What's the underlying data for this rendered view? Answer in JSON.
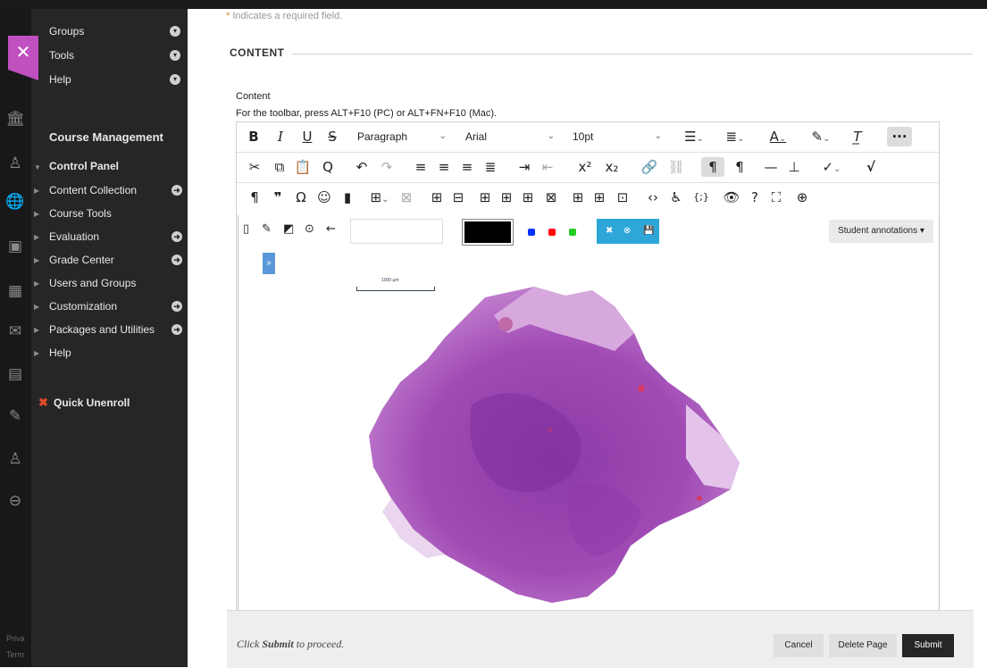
{
  "required_note": {
    "star": "*",
    "text": "Indicates a required field."
  },
  "nav": {
    "top_items": [
      {
        "label": "Groups"
      },
      {
        "label": "Tools"
      },
      {
        "label": "Help"
      }
    ],
    "course_management": "Course Management",
    "control_panel": "Control Panel",
    "panel_items": [
      {
        "label": "Content Collection",
        "has_arrow": true
      },
      {
        "label": "Course Tools",
        "has_arrow": false
      },
      {
        "label": "Evaluation",
        "has_arrow": true
      },
      {
        "label": "Grade Center",
        "has_arrow": true
      },
      {
        "label": "Users and Groups",
        "has_arrow": false
      },
      {
        "label": "Customization",
        "has_arrow": true
      },
      {
        "label": "Packages and Utilities",
        "has_arrow": true
      },
      {
        "label": "Help",
        "has_arrow": false
      }
    ],
    "quick_unenroll": "Quick Unenroll",
    "footer_privacy": "Priva",
    "footer_terms": "Term"
  },
  "section": {
    "title": "CONTENT"
  },
  "field": {
    "label": "Content",
    "hint": "For the toolbar, press ALT+F10 (PC) or ALT+FN+F10 (Mac)."
  },
  "toolbar": {
    "paragraph_select": "Paragraph",
    "font_select": "Arial",
    "size_select": "10pt"
  },
  "annotation": {
    "student_annotations": "Student annotations ▾",
    "scale_label": "1000 µm",
    "expand": "»",
    "colors": [
      "#0033ff",
      "#ff0000",
      "#22cc22"
    ],
    "pen_color": "#000000",
    "accent": "#2ea6d8"
  },
  "footer": {
    "prefix": "Click",
    "bold": "Submit",
    "suffix": "to proceed.",
    "cancel": "Cancel",
    "delete_page": "Delete Page",
    "submit": "Submit"
  }
}
